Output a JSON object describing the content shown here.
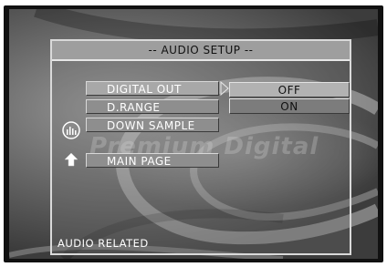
{
  "menu": {
    "title": "-- AUDIO SETUP --",
    "items": [
      {
        "label": "DIGITAL OUT"
      },
      {
        "label": "D.RANGE"
      },
      {
        "label": "DOWN SAMPLE"
      }
    ],
    "main_page_label": "MAIN PAGE",
    "selected_item": "DIGITAL OUT"
  },
  "options": [
    {
      "label": "OFF"
    },
    {
      "label": "ON"
    }
  ],
  "status_text": "AUDIO RELATED",
  "watermark": "Premium Digital",
  "icons": {
    "audio": "audio-bars-icon",
    "up": "up-arrow-icon",
    "pointer": "right-triangle-pointer-icon"
  },
  "colors": {
    "panel_border": "#d9d9d9",
    "title_bar": "#9e9e9e",
    "menu_button": "#8e8e8e",
    "option_off": "#b2b2b2",
    "option_on": "#7c7c7c"
  }
}
